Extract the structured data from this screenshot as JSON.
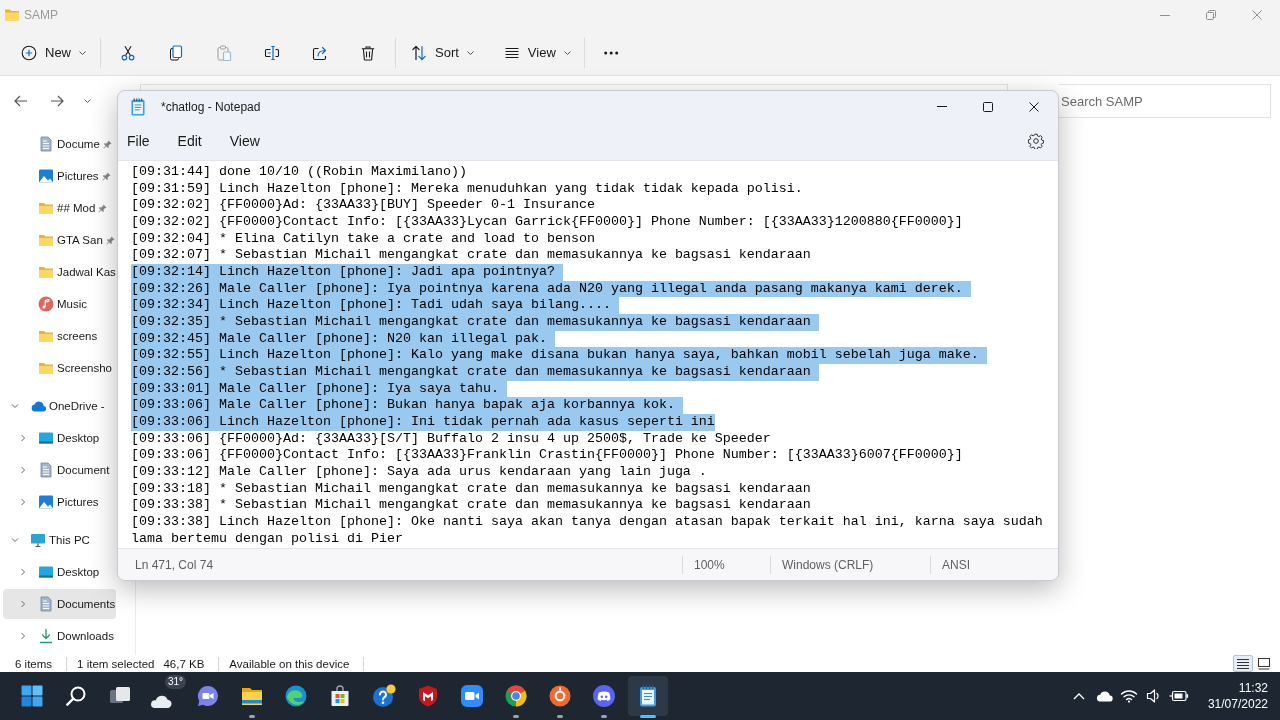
{
  "explorer": {
    "title": "SAMP",
    "command_bar": [
      [
        {
          "kind": "new",
          "label": "New",
          "disabled": false
        }
      ],
      [
        {
          "kind": "cut",
          "disabled": false
        },
        {
          "kind": "copy",
          "disabled": false
        },
        {
          "kind": "paste",
          "disabled": true
        },
        {
          "kind": "rename",
          "disabled": false
        },
        {
          "kind": "share",
          "disabled": false
        },
        {
          "kind": "delete",
          "disabled": false
        }
      ],
      [
        {
          "kind": "sort",
          "label": "Sort",
          "disabled": false
        },
        {
          "kind": "view",
          "label": "View",
          "disabled": false
        }
      ],
      [
        {
          "kind": "more",
          "disabled": false
        }
      ]
    ],
    "search": {
      "placeholder": "Search SAMP"
    },
    "navigation_pane": {
      "quick_access": [
        {
          "kind": "documents",
          "label": "Docume",
          "pinned": true,
          "selected": false
        },
        {
          "kind": "pictures",
          "label": "Pictures",
          "pinned": true,
          "selected": false
        },
        {
          "kind": "folder",
          "label": "## Mod",
          "pinned": true,
          "selected": false
        },
        {
          "kind": "folder",
          "label": "GTA San",
          "pinned": true,
          "selected": false
        },
        {
          "kind": "folder",
          "label": "Jadwal Kas",
          "pinned": false,
          "selected": false
        },
        {
          "kind": "music",
          "label": "Music",
          "pinned": false,
          "selected": false
        },
        {
          "kind": "folder",
          "label": "screens",
          "pinned": false,
          "selected": false
        },
        {
          "kind": "folder",
          "label": "Screensho",
          "pinned": false,
          "selected": false
        }
      ],
      "tree": [
        {
          "kind": "cloud",
          "label": "OneDrive -",
          "expanded": true,
          "selected": false,
          "children": [
            {
              "kind": "desktop",
              "label": "Desktop",
              "expanded": false,
              "selected": false
            },
            {
              "kind": "documents",
              "label": "Document",
              "expanded": false,
              "selected": false
            },
            {
              "kind": "pictures",
              "label": "Pictures",
              "expanded": false,
              "selected": false
            }
          ]
        },
        {
          "kind": "pc",
          "label": "This PC",
          "expanded": true,
          "selected": false,
          "children": [
            {
              "kind": "desktop",
              "label": "Desktop",
              "expanded": false,
              "selected": false
            },
            {
              "kind": "documents",
              "label": "Documents",
              "expanded": false,
              "selected": true
            },
            {
              "kind": "downloads",
              "label": "Downloads",
              "expanded": false,
              "selected": false
            }
          ]
        }
      ]
    },
    "status_bar": {
      "item_count": "6 items",
      "selection": "1 item selected",
      "size": "46,7 KB",
      "availability": "Available on this device",
      "views": [
        {
          "kind": "details",
          "selected": true
        },
        {
          "kind": "tiles",
          "selected": false
        }
      ]
    }
  },
  "notepad": {
    "title": "*chatlog - Notepad",
    "menu": [
      "File",
      "Edit",
      "View"
    ],
    "lines": [
      {
        "text": "[09:31:44] done 10/10 ((Robin Maximilano))",
        "selected": false
      },
      {
        "text": "[09:31:59] Linch Hazelton [phone]: Mereka menuduhkan yang tidak tidak kepada polisi.",
        "selected": false
      },
      {
        "text": "[09:32:02] {FF0000}Ad: {33AA33}[BUY] Speeder 0-1 Insurance",
        "selected": false
      },
      {
        "text": "[09:32:02] {FF0000}Contact Info: [{33AA33}Lycan Garrick{FF0000}] Phone Number: [{33AA33}1200880{FF0000}]",
        "selected": false
      },
      {
        "text": "[09:32:04] * Elina Catilyn take a crate and load to benson",
        "selected": false
      },
      {
        "text": "[09:32:07] * Sebastian Michail mengangkat crate dan memasukannya ke bagsasi kendaraan",
        "selected": false
      },
      {
        "text": "[09:32:14] Linch Hazelton [phone]: Jadi apa pointnya?",
        "selected": true
      },
      {
        "text": "[09:32:26] Male Caller [phone]: Iya pointnya karena ada N20 yang illegal anda pasang makanya kami derek.",
        "selected": true
      },
      {
        "text": "[09:32:34] Linch Hazelton [phone]: Tadi udah saya bilang....",
        "selected": true
      },
      {
        "text": "[09:32:35] * Sebastian Michail mengangkat crate dan memasukannya ke bagsasi kendaraan",
        "selected": true
      },
      {
        "text": "[09:32:45] Male Caller [phone]: N20 kan illegal pak.",
        "selected": true
      },
      {
        "text": "[09:32:55] Linch Hazelton [phone]: Kalo yang make disana bukan hanya saya, bahkan mobil sebelah juga make.",
        "selected": true
      },
      {
        "text": "[09:32:56] * Sebastian Michail mengangkat crate dan memasukannya ke bagsasi kendaraan",
        "selected": true
      },
      {
        "text": "[09:33:01] Male Caller [phone]: Iya saya tahu.",
        "selected": true
      },
      {
        "text": "[09:33:06] Male Caller [phone]: Bukan hanya bapak aja korbannya kok.",
        "selected": true
      },
      {
        "text": "[09:33:06] Linch Hazelton [phone]: Ini tidak pernah ada kasus seperti ini",
        "selected": true
      },
      {
        "text": "[09:33:06] {FF0000}Ad: {33AA33}[S/T] Buffalo 2 insu 4 up 2500$, Trade ke Speeder",
        "selected": false
      },
      {
        "text": "[09:33:06] {FF0000}Contact Info: [{33AA33}Franklin Crastin{FF0000}] Phone Number: [{33AA33}6007{FF0000}]",
        "selected": false
      },
      {
        "text": "[09:33:12] Male Caller [phone]: Saya ada urus kendaraan yang lain juga .",
        "selected": false
      },
      {
        "text": "[09:33:18] * Sebastian Michail mengangkat crate dan memasukannya ke bagsasi kendaraan",
        "selected": false
      },
      {
        "text": "[09:33:38] * Sebastian Michail mengangkat crate dan memasukannya ke bagsasi kendaraan",
        "selected": false
      },
      {
        "text": "[09:33:38] Linch Hazelton [phone]: Oke nanti saya akan tanya dengan atasan bapak terkait hal ini, karna saya sudah lama bertemu dengan polisi di Pier",
        "selected": false
      }
    ],
    "status_bar": {
      "position": "Ln 471, Col 74",
      "zoom": "100%",
      "line_ending": "Windows (CRLF)",
      "encoding": "ANSI"
    }
  },
  "taskbar": {
    "apps": [
      {
        "kind": "start",
        "running": false,
        "active": false
      },
      {
        "kind": "search",
        "running": false,
        "active": false
      },
      {
        "kind": "taskview",
        "running": false,
        "active": false
      },
      {
        "kind": "weather",
        "label": "31°",
        "running": false,
        "active": false
      },
      {
        "kind": "chat",
        "running": false,
        "active": false
      },
      {
        "kind": "files",
        "running": true,
        "active": false
      },
      {
        "kind": "wave",
        "running": false,
        "active": false
      },
      {
        "kind": "store",
        "running": false,
        "active": false
      },
      {
        "kind": "help",
        "running": false,
        "active": false
      },
      {
        "kind": "shield",
        "running": false,
        "active": false
      },
      {
        "kind": "video",
        "running": false,
        "active": false
      },
      {
        "kind": "sectors",
        "running": true,
        "active": false
      },
      {
        "kind": "ring",
        "running": true,
        "active": false
      },
      {
        "kind": "gamepad",
        "running": true,
        "active": false
      },
      {
        "kind": "notepad",
        "running": true,
        "active": true
      }
    ],
    "tray": [
      {
        "kind": "overflow"
      },
      {
        "kind": "cloud"
      },
      {
        "kind": "wifi"
      },
      {
        "kind": "volume"
      },
      {
        "kind": "battery"
      }
    ],
    "time": "11:32",
    "date": "31/07/2022"
  }
}
